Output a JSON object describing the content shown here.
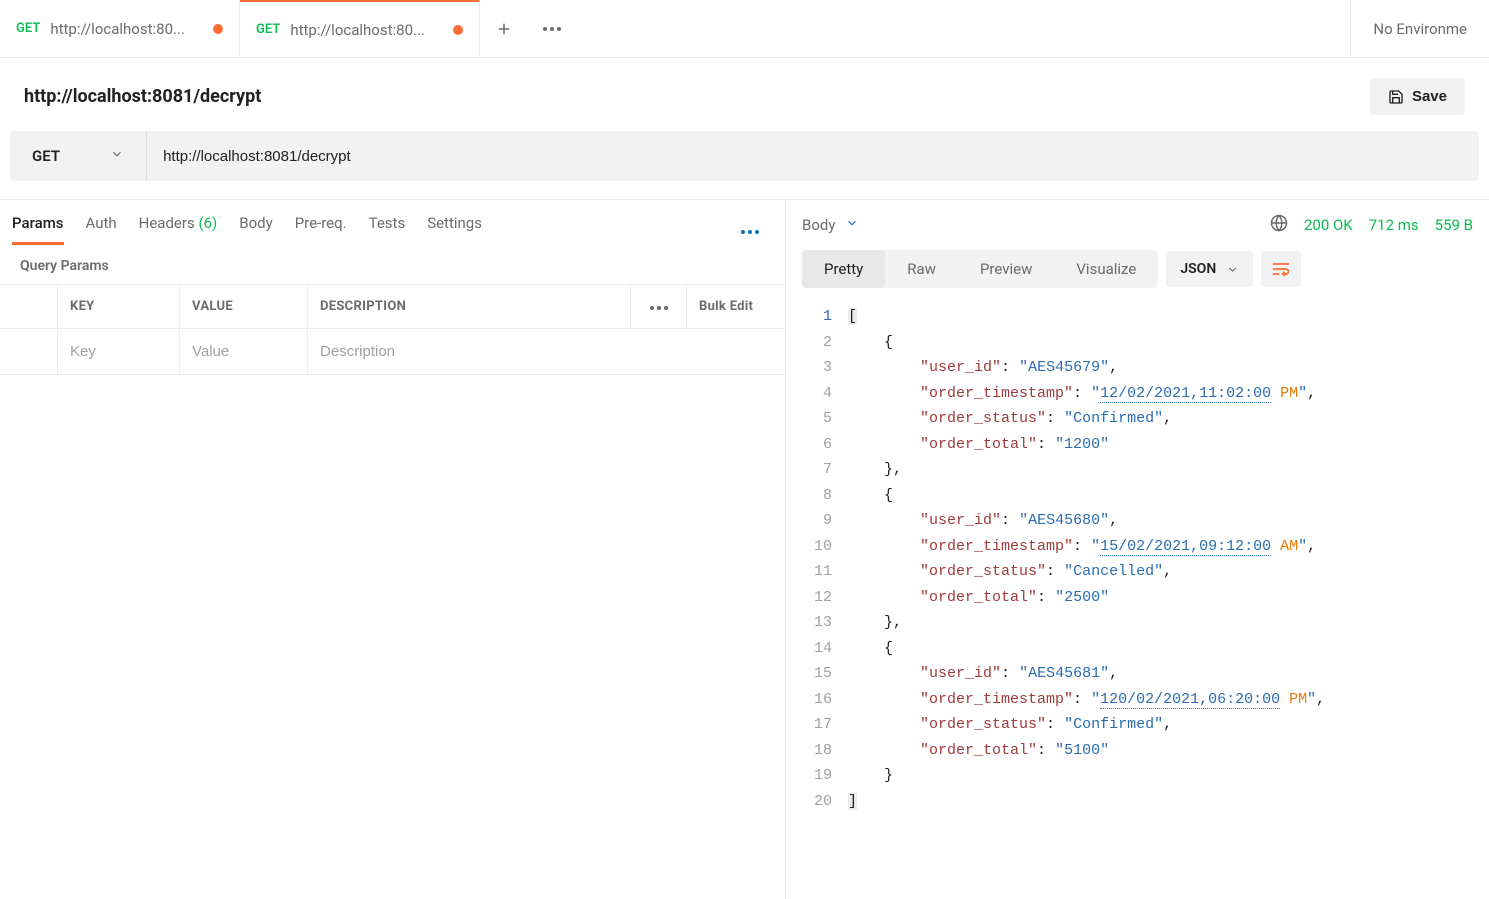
{
  "tabs": [
    {
      "method": "GET",
      "title": "http://localhost:80...",
      "unsaved": true,
      "active": false
    },
    {
      "method": "GET",
      "title": "http://localhost:80...",
      "unsaved": true,
      "active": true
    }
  ],
  "env_label": "No Environme",
  "request": {
    "title": "http://localhost:8081/decrypt",
    "method": "GET",
    "url": "http://localhost:8081/decrypt",
    "save_label": "Save"
  },
  "subtabs": {
    "params": "Params",
    "auth": "Auth",
    "headers": "Headers",
    "headers_count": "(6)",
    "body": "Body",
    "prereq": "Pre-req.",
    "tests": "Tests",
    "settings": "Settings"
  },
  "query_params_label": "Query Params",
  "params_table": {
    "headers": {
      "key": "KEY",
      "value": "VALUE",
      "desc": "DESCRIPTION",
      "bulk": "Bulk Edit"
    },
    "placeholders": {
      "key": "Key",
      "value": "Value",
      "desc": "Description"
    }
  },
  "response": {
    "body_label": "Body",
    "status": "200 OK",
    "time": "712 ms",
    "size": "559 B",
    "views": {
      "pretty": "Pretty",
      "raw": "Raw",
      "preview": "Preview",
      "visualize": "Visualize"
    },
    "format": "JSON",
    "json": [
      {
        "user_id": "AES45679",
        "order_timestamp": "12/02/2021,11:02:00 PM",
        "order_status": "Confirmed",
        "order_total": "1200"
      },
      {
        "user_id": "AES45680",
        "order_timestamp": "15/02/2021,09:12:00 AM",
        "order_status": "Cancelled",
        "order_total": "2500"
      },
      {
        "user_id": "AES45681",
        "order_timestamp": "120/02/2021,06:20:00 PM",
        "order_status": "Confirmed",
        "order_total": "5100"
      }
    ]
  }
}
